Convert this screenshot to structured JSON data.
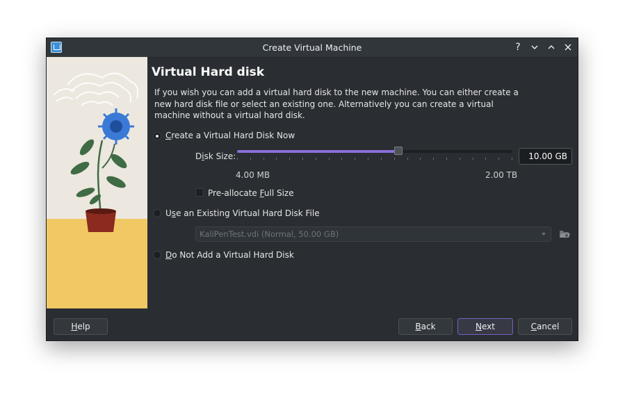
{
  "window": {
    "title": "Create Virtual Machine",
    "help_glyph": "?",
    "minimize_glyph": "⌄",
    "maximize_glyph": "⌃",
    "close_glyph": "✕"
  },
  "page": {
    "heading": "Virtual Hard disk",
    "description": "If you wish you can add a virtual hard disk to the new machine. You can either create a new hard disk file or select an existing one. Alternatively you can create a virtual machine without a virtual hard disk."
  },
  "options": {
    "create_new": {
      "pre": "",
      "mnemonic": "C",
      "post": "reate a Virtual Hard Disk Now",
      "checked": true
    },
    "use_existing": {
      "pre": "U",
      "mnemonic": "s",
      "post": "e an Existing Virtual Hard Disk File",
      "checked": false
    },
    "none": {
      "pre": "",
      "mnemonic": "D",
      "post": "o Not Add a Virtual Hard Disk",
      "checked": false
    }
  },
  "disk": {
    "size_label_pre": "D",
    "size_label_mnemonic": "i",
    "size_label_post": "sk Size:",
    "size_value": "10.00 GB",
    "slider_fraction": 0.587,
    "min_label": "4.00 MB",
    "max_label": "2.00 TB",
    "preallocate_pre": "Pre-allocate ",
    "preallocate_mnemonic": "F",
    "preallocate_post": "ull Size",
    "preallocate_checked": false
  },
  "existing_disk": {
    "selected": "KaliPenTest.vdi (Normal, 50.00 GB)"
  },
  "buttons": {
    "help_mnemonic": "H",
    "help_rest": "elp",
    "back_mnemonic": "B",
    "back_rest": "ack",
    "next_mnemonic": "N",
    "next_rest": "ext",
    "cancel_mnemonic": "C",
    "cancel_rest": "ancel"
  },
  "colors": {
    "accent": "#8a6fd9",
    "background": "#2a2e32",
    "flower": "#3a7ad6",
    "pot": "#8b2a1f",
    "leaf": "#3f6b45"
  },
  "icons": {
    "app": "virtualbox-icon",
    "folder": "folder-open-icon",
    "dropdown": "chevron-down-icon"
  }
}
